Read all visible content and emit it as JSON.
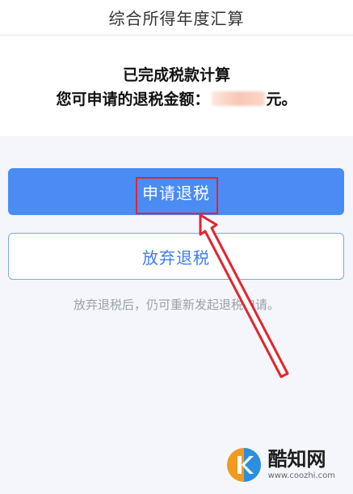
{
  "header": {
    "title": "综合所得年度汇算"
  },
  "result": {
    "status_text": "已完成税款计算",
    "refund_prefix": "您可申请的退税金额：",
    "refund_suffix": "元。"
  },
  "actions": {
    "apply_label": "申请退税",
    "abandon_label": "放弃退税",
    "hint_text": "放弃退税后，仍可重新发起退税申请。"
  },
  "annotation": {
    "highlight_color": "#e2252f"
  },
  "watermark": {
    "name": "酷知网",
    "url": "www.coozhi.com",
    "logo_icon": "coozhi-logo-icon"
  },
  "colors": {
    "primary": "#4a8cf3",
    "page_bg": "#f4f6fb",
    "secondary_text": "#3d7ee9"
  }
}
